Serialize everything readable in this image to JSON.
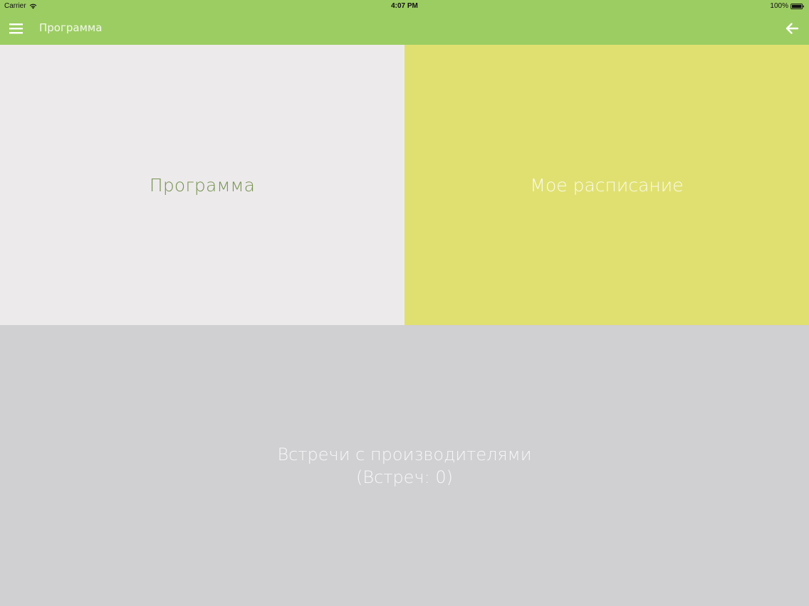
{
  "status_bar": {
    "carrier": "Carrier",
    "time": "4:07 PM",
    "battery": "100%"
  },
  "nav": {
    "title": "Программа",
    "menu_icon": "hamburger-menu-icon",
    "back_icon": "arrow-left-icon"
  },
  "tiles": {
    "program": "Программа",
    "schedule": "Мое расписание",
    "meetings_line1": "Встречи с производителями",
    "meetings_line2": "(Встреч: 0)"
  },
  "colors": {
    "header": "#9ccd62",
    "program_tile": "#edeaec",
    "schedule_tile": "#e0e071",
    "meetings_tile": "#d0cfd2",
    "program_text": "#76934f"
  }
}
